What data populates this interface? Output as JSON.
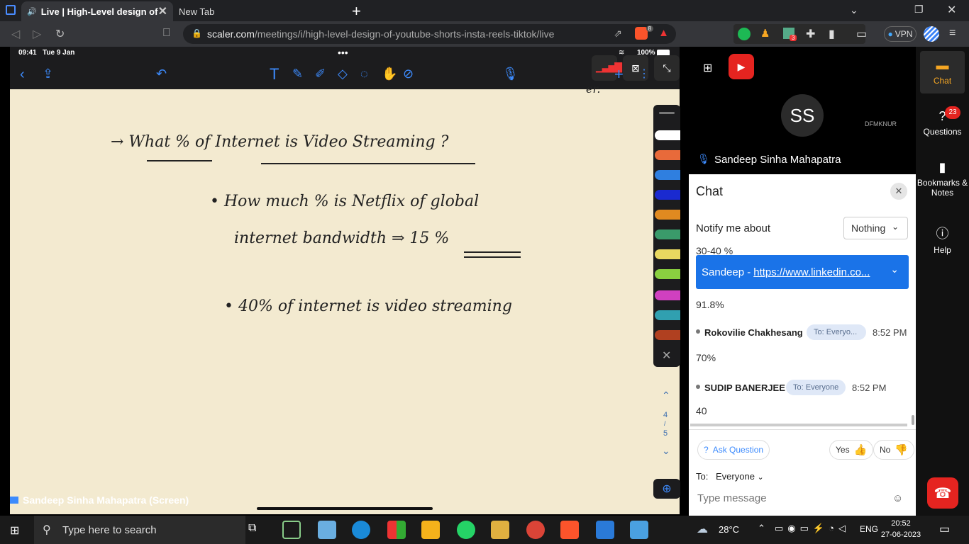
{
  "browser": {
    "tabs": [
      {
        "label": "Live | High-Level design of You",
        "active": true
      },
      {
        "label": "New Tab",
        "active": false
      }
    ],
    "url_domain": "scaler.com",
    "url_path": "/meetings/i/high-level-design-of-youtube-shorts-insta-reels-tiktok/live",
    "extension_badge_brave": "8",
    "extension_badge_ext": "3",
    "vpn_label": "VPN"
  },
  "ipad": {
    "time": "09:41",
    "date": "Tue 9 Jan",
    "battery": "100%",
    "page_top": "4",
    "page_bottom": "5"
  },
  "note": {
    "line1": "→ What % of Internet is Video Streaming ?",
    "line2": "• How much % is Netflix of global",
    "line3": "internet bandwidth ⇒ 15 %",
    "line4": "• 40% of internet is video streaming",
    "corner": "er."
  },
  "screen_label": "Sandeep Sinha Mahapatra (Screen)",
  "video": {
    "avatar_initials": "SS",
    "tag": "DFMKNUR",
    "presenter_name": "Sandeep Sinha Mahapatra"
  },
  "chat": {
    "title": "Chat",
    "notify_label": "Notify me about",
    "notify_value": "Nothing",
    "cut_text": "30-40 %",
    "pinned_sender": "Sandeep - ",
    "pinned_link": "https://www.linkedin.co...",
    "messages": [
      {
        "text": "91.8%"
      },
      {
        "sender": "Rokovilie Chakhesang",
        "to": "To: Everyo...",
        "time": "8:52 PM",
        "text": "70%"
      },
      {
        "sender": "SUDIP BANERJEE",
        "to": "To: Everyone",
        "time": "8:52 PM",
        "text": "40"
      }
    ],
    "ask_question": "Ask Question",
    "yes_label": "Yes",
    "no_label": "No",
    "to_label": "To:",
    "to_value": "Everyone",
    "input_placeholder": "Type message"
  },
  "sidebar": {
    "items": [
      {
        "label": "Chat",
        "icon": "chat-icon"
      },
      {
        "label": "Questions",
        "icon": "question-icon",
        "badge": "23"
      },
      {
        "label": "Bookmarks & Notes",
        "icon": "bookmark-icon"
      },
      {
        "label": "Help",
        "icon": "info-icon"
      }
    ]
  },
  "taskbar": {
    "search_placeholder": "Type here to search",
    "weather": "28°C",
    "lang": "ENG",
    "time": "20:52",
    "date": "27-06-2023"
  },
  "colors": {
    "accent": "#1a73e8",
    "note_bg": "#f3ead0",
    "end_call": "#e52420",
    "badge": "#e52420"
  }
}
